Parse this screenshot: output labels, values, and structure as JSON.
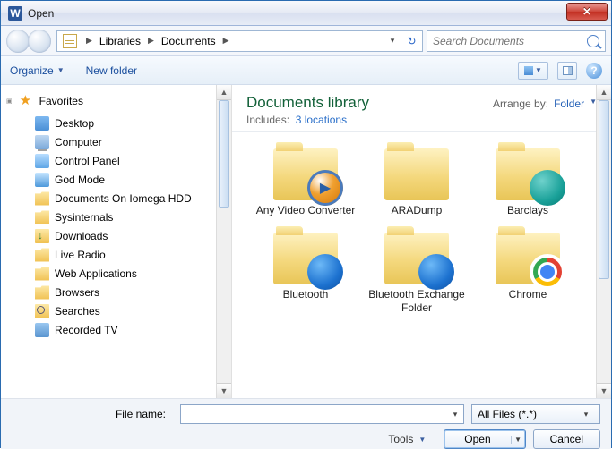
{
  "window": {
    "title": "Open"
  },
  "breadcrumb": {
    "root": "Libraries",
    "item": "Documents"
  },
  "search": {
    "placeholder": "Search Documents"
  },
  "toolbar": {
    "organize": "Organize",
    "newfolder": "New folder"
  },
  "sidebar": {
    "favorites_label": "Favorites",
    "items": [
      {
        "label": "Desktop",
        "icon": "ic-desktop"
      },
      {
        "label": "Computer",
        "icon": "ic-computer"
      },
      {
        "label": "Control Panel",
        "icon": "ic-panel"
      },
      {
        "label": "God Mode",
        "icon": "ic-god"
      },
      {
        "label": "Documents On Iomega HDD",
        "icon": "ic-folder"
      },
      {
        "label": "Sysinternals",
        "icon": "ic-folder"
      },
      {
        "label": "Downloads",
        "icon": "ic-dl"
      },
      {
        "label": "Live Radio",
        "icon": "ic-folder"
      },
      {
        "label": "Web Applications",
        "icon": "ic-folder"
      },
      {
        "label": "Browsers",
        "icon": "ic-folder"
      },
      {
        "label": "Searches",
        "icon": "ic-search"
      },
      {
        "label": "Recorded TV",
        "icon": "ic-tv"
      }
    ]
  },
  "content": {
    "title": "Documents library",
    "includes_label": "Includes:",
    "includes_link": "3 locations",
    "arrange_label": "Arrange by:",
    "arrange_value": "Folder",
    "items": [
      {
        "label": "Any Video Converter",
        "overlay": "avc"
      },
      {
        "label": "ARADump",
        "overlay": ""
      },
      {
        "label": "Barclays",
        "overlay": "barc"
      },
      {
        "label": "Bluetooth",
        "overlay": "bt"
      },
      {
        "label": "Bluetooth Exchange Folder",
        "overlay": "bt"
      },
      {
        "label": "Chrome",
        "overlay": "chrome"
      }
    ]
  },
  "footer": {
    "filename_label": "File name:",
    "filename_value": "",
    "filter": "All Files (*.*)",
    "tools": "Tools",
    "open": "Open",
    "cancel": "Cancel"
  }
}
